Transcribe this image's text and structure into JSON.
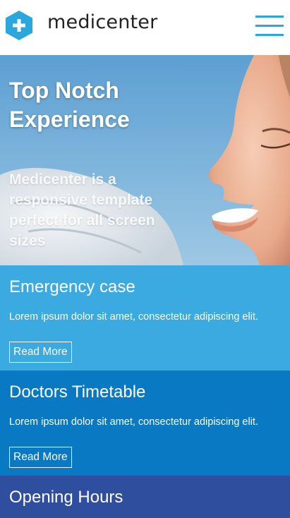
{
  "header": {
    "brand": "medicenter",
    "logo_icon": "plus-hexagon-icon",
    "menu_icon": "hamburger-menu-icon",
    "accent_color": "#2aa8dd"
  },
  "hero": {
    "title": "Top Notch Experience",
    "subtitle": "Medicenter is a responsive template perfect for all screen sizes"
  },
  "boxes": [
    {
      "title": "Emergency case",
      "text": "Lorem ipsum dolor sit amet, consectetur adipiscing elit.",
      "button": "Read More",
      "color": "#3baae0"
    },
    {
      "title": "Doctors Timetable",
      "text": "Lorem ipsum dolor sit amet, consectetur adipiscing elit.",
      "button": "Read More",
      "color": "#0979c3"
    },
    {
      "title": "Opening Hours",
      "color": "#2f4e9d"
    }
  ]
}
